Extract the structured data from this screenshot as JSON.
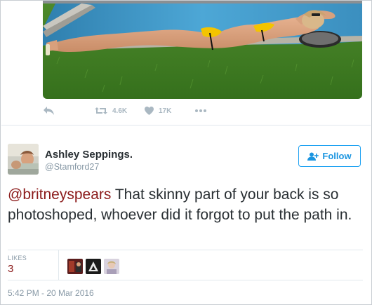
{
  "media": {
    "description_icon": "photo-media"
  },
  "actions": {
    "reply_icon": "reply-icon",
    "retweet_icon": "retweet-icon",
    "retweet_count": "4.6K",
    "like_icon": "heart-icon",
    "like_count": "17K",
    "more_icon": "more-icon"
  },
  "author": {
    "name": "Ashley Seppings.",
    "handle": "@Stamford27"
  },
  "follow": {
    "label": "Follow",
    "icon": "add-user-icon"
  },
  "tweet": {
    "mention": "@britneyspears",
    "text": " That skinny part of your back is so photoshoped, whoever did it forgot to put the path in."
  },
  "stats": {
    "likes_label": "LIKES",
    "likes_count": "3"
  },
  "timestamp": "5:42 PM - 20 Mar 2016",
  "colors": {
    "accent": "#1da1f2",
    "mention": "#8b1a1a",
    "muted": "#8899a6",
    "text": "#292f33"
  }
}
